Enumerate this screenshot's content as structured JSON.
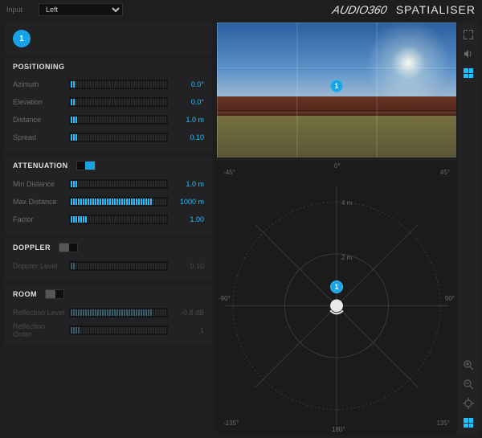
{
  "header": {
    "input_label": "Input",
    "input_value": "Left",
    "brand_logo": "AUDIO360",
    "brand_name": "SPATIALISER"
  },
  "chip": {
    "label": "1"
  },
  "sections": {
    "positioning": {
      "title": "POSITIONING",
      "params": [
        {
          "label": "Azimuth",
          "value": "0.0°",
          "fill": 2,
          "ticks": 40
        },
        {
          "label": "Elevation",
          "value": "0.0°",
          "fill": 2,
          "ticks": 40
        },
        {
          "label": "Distance",
          "value": "1.0 m",
          "fill": 3,
          "ticks": 40
        },
        {
          "label": "Spread",
          "value": "0.10",
          "fill": 3,
          "ticks": 40
        }
      ]
    },
    "attenuation": {
      "title": "ATTENUATION",
      "enabled": true,
      "params": [
        {
          "label": "Min Distance",
          "value": "1.0 m",
          "fill": 3,
          "ticks": 40
        },
        {
          "label": "Max Distance",
          "value": "1000 m",
          "fill": 34,
          "ticks": 40
        },
        {
          "label": "Factor",
          "value": "1.00",
          "fill": 7,
          "ticks": 40
        }
      ]
    },
    "doppler": {
      "title": "DOPPLER",
      "enabled": false,
      "params": [
        {
          "label": "Doppler Level",
          "value": "0.10",
          "fill": 2,
          "ticks": 40
        }
      ]
    },
    "room": {
      "title": "ROOM",
      "enabled": false,
      "params": [
        {
          "label": "Reflection Level",
          "value": "-0.8 dB",
          "fill": 34,
          "ticks": 40
        },
        {
          "label": "Reflection Order",
          "value": "1",
          "fill": 4,
          "ticks": 40
        }
      ]
    }
  },
  "preview": {
    "marker_label": "1"
  },
  "polar": {
    "marker_label": "1",
    "labels": {
      "top": "0°",
      "bottom": "180°",
      "left_top": "-45°",
      "right_top": "45°",
      "left": "-90°",
      "right": "90°",
      "left_bot": "-135°",
      "right_bot": "135°",
      "r1": "2 m",
      "r2": "4 m"
    }
  },
  "tools_top": [
    "fullscreen",
    "volume",
    "grid"
  ],
  "tools_bottom": [
    "zoom-in",
    "zoom-out",
    "target",
    "grid2"
  ]
}
